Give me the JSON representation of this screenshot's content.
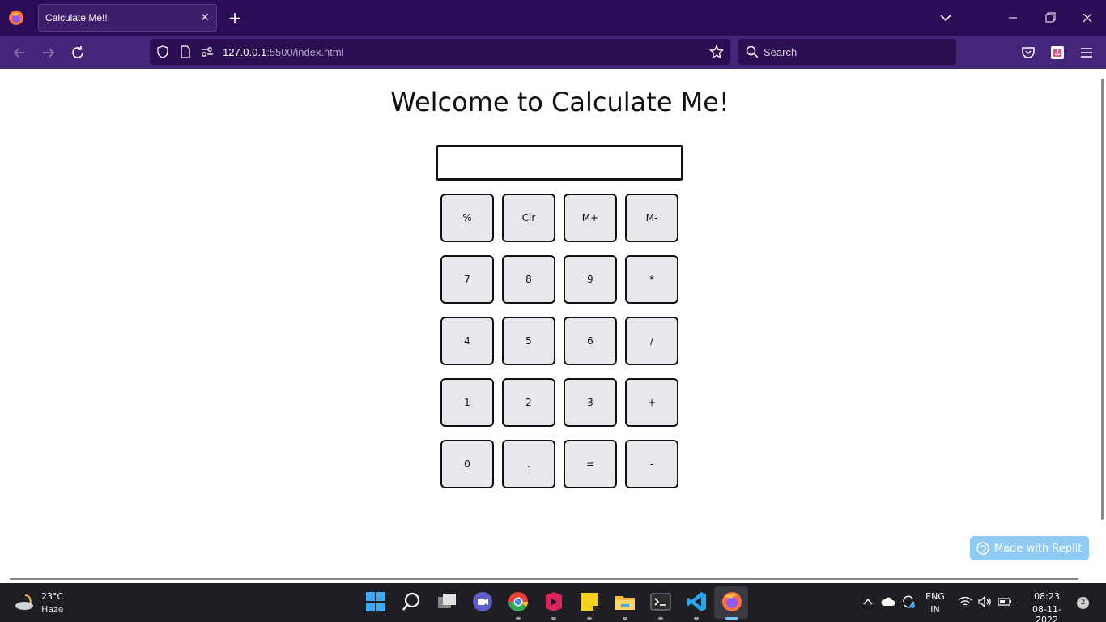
{
  "browser": {
    "tab_title": "Calculate Me!!",
    "tab_close": "✕",
    "new_tab": "+",
    "url_host": "127.0.0.1",
    "url_rest": ":5500/index.html",
    "search_placeholder": "Search"
  },
  "page": {
    "title": "Welcome to Calculate Me!",
    "display_value": "",
    "keys": [
      "%",
      "Clr",
      "M+",
      "M-",
      "7",
      "8",
      "9",
      "*",
      "4",
      "5",
      "6",
      "/",
      "1",
      "2",
      "3",
      "+",
      "0",
      ".",
      "=",
      "-"
    ],
    "replit_badge": "Made with Replit"
  },
  "taskbar": {
    "weather_temp": "23°C",
    "weather_desc": "Haze",
    "lang_top": "ENG",
    "lang_bottom": "IN",
    "time": "08:23",
    "date": "08-11-2022",
    "notification_count": "2"
  },
  "colors": {
    "tab_strip": "#2b0c57",
    "toolbar": "#43267a",
    "key_bg": "#e8e7ec",
    "replit_badge": "#8fcaf4"
  }
}
